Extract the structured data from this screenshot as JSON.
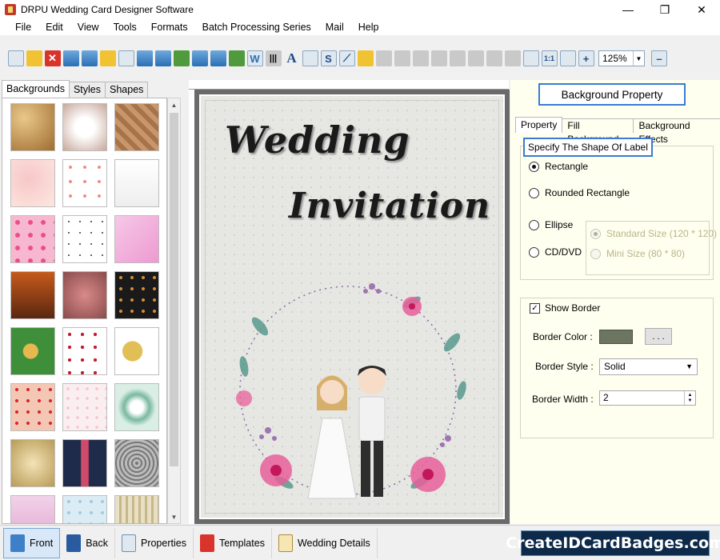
{
  "window": {
    "title": "DRPU Wedding Card Designer Software"
  },
  "menu": [
    "File",
    "Edit",
    "View",
    "Tools",
    "Formats",
    "Batch Processing Series",
    "Mail",
    "Help"
  ],
  "toolbar": {
    "zoom_value": "125%"
  },
  "left_panel": {
    "tabs": [
      "Backgrounds",
      "Styles",
      "Shapes"
    ],
    "active_tab": "Backgrounds"
  },
  "card": {
    "title_line1": "Wedding",
    "title_line2": "Invitation"
  },
  "right_panel": {
    "header_button": "Background Property",
    "tabs": [
      "Property",
      "Fill Background",
      "Background Effects"
    ],
    "shape_group_label": "Specify The Shape Of Label",
    "shapes": {
      "rectangle": "Rectangle",
      "rounded_rectangle": "Rounded Rectangle",
      "ellipse": "Ellipse",
      "cd_dvd": "CD/DVD"
    },
    "sizes": {
      "standard": "Standard Size (120 * 120)",
      "mini": "Mini Size (80 * 80)"
    },
    "border": {
      "show_border_label": "Show Border",
      "show_border_checked": true,
      "color_label": "Border Color :",
      "color_value": "#6b7560",
      "color_button": ". . .",
      "style_label": "Border Style :",
      "style_value": "Solid",
      "width_label": "Border Width :",
      "width_value": "2"
    }
  },
  "bottom_bar": [
    "Front",
    "Back",
    "Properties",
    "Templates",
    "Wedding Details"
  ],
  "brand_text": "CreateIDCardBadges.com"
}
